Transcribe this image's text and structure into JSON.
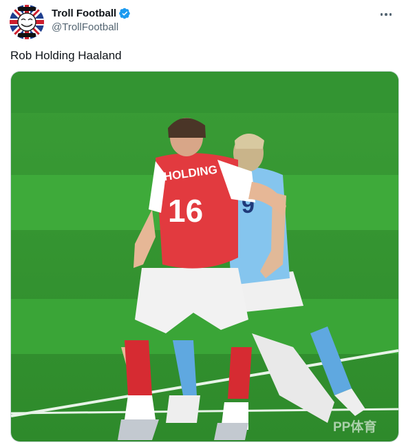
{
  "author": {
    "display_name": "Troll Football",
    "handle": "@TrollFootball",
    "verified": true,
    "avatar_icon": "troll-face-union-jack-avatar"
  },
  "tweet": {
    "text": "Rob Holding Haaland"
  },
  "media": {
    "description_icon": "football-photo",
    "player_front": {
      "name": "HOLDING",
      "number": "16"
    },
    "player_back": {
      "number": "9"
    },
    "watermark": "PP体育"
  },
  "colors": {
    "verified": "#1d9bf0",
    "pitch_light": "#3fa83a",
    "pitch_dark": "#2f8f2c",
    "arsenal_red": "#e23a3f",
    "city_blue": "#7ec3ef"
  }
}
